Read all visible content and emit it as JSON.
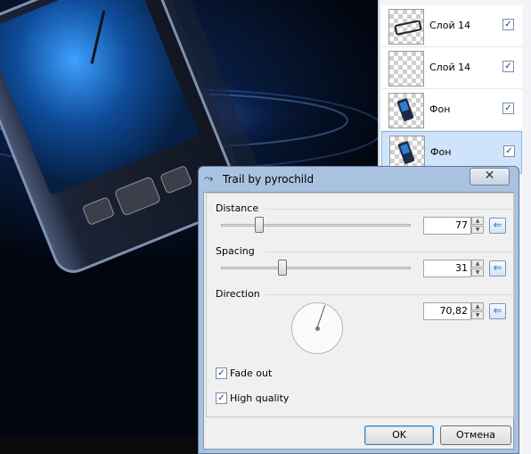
{
  "layers": [
    {
      "name": "Слой 14",
      "visible": true,
      "thumb": "shape-icon",
      "selected": false
    },
    {
      "name": "Слой 14",
      "visible": true,
      "thumb": "transparent",
      "selected": false
    },
    {
      "name": "Фон",
      "visible": true,
      "thumb": "phone-icon",
      "selected": false
    },
    {
      "name": "Фон",
      "visible": true,
      "thumb": "phone-icon",
      "selected": true
    }
  ],
  "dialog": {
    "title": "Trail by pyrochild",
    "close_symbol": "✕",
    "distance": {
      "label": "Distance",
      "value": "77",
      "slider_fraction": 0.18
    },
    "spacing": {
      "label": "Spacing",
      "value": "31",
      "slider_fraction": 0.31
    },
    "direction": {
      "label": "Direction",
      "value": "70,82",
      "angle_degrees": 70.82
    },
    "fade_out": {
      "label": "Fade out",
      "checked": true
    },
    "high_quality": {
      "label": "High quality",
      "checked": true
    },
    "ok_label": "OK",
    "cancel_label": "Отмена"
  },
  "icons": {
    "check": "✓",
    "reset": "⇐",
    "spin_up": "▲",
    "spin_down": "▼",
    "title_icon": "⤳"
  },
  "colors": {
    "selection": "#cfe3fa",
    "accent": "#3c7fb1",
    "title_bar": "#a9c2df"
  }
}
